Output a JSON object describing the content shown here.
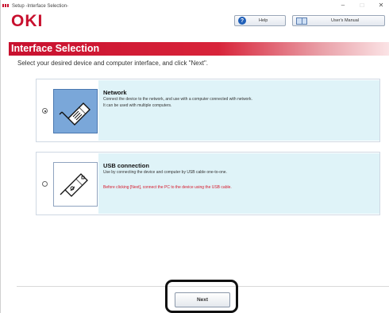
{
  "window": {
    "title": "Setup -Interface Selection-",
    "minimize_glyph": "–",
    "maximize_glyph": "□",
    "close_glyph": "✕"
  },
  "header": {
    "logo_text": "OKI",
    "help_label": "Help",
    "help_icon_glyph": "?",
    "manual_label": "User's Manual"
  },
  "banner": {
    "title": "Interface Selection"
  },
  "instruction": "Select your desired device and computer interface, and click \"Next\".",
  "options": [
    {
      "title": "Network",
      "desc_line1": "Connect the device to the network, and use with a computer connected with network.",
      "desc_line2": "It can be used with multiple computers.",
      "selected": true,
      "icon": "network-cable-icon"
    },
    {
      "title": "USB connection",
      "desc_line1": "Use by connecting the device and computer by USB cable one-to-one.",
      "warning": "Before clicking [Next], connect the PC to the device using the USB cable.",
      "selected": false,
      "icon": "usb-cable-icon"
    }
  ],
  "footer": {
    "next_label": "Next"
  },
  "colors": {
    "brand_red": "#c8102e",
    "option_bg": "#dff3f8",
    "selected_icon_bg": "#7aa7d9",
    "warning_red": "#d6182b"
  }
}
